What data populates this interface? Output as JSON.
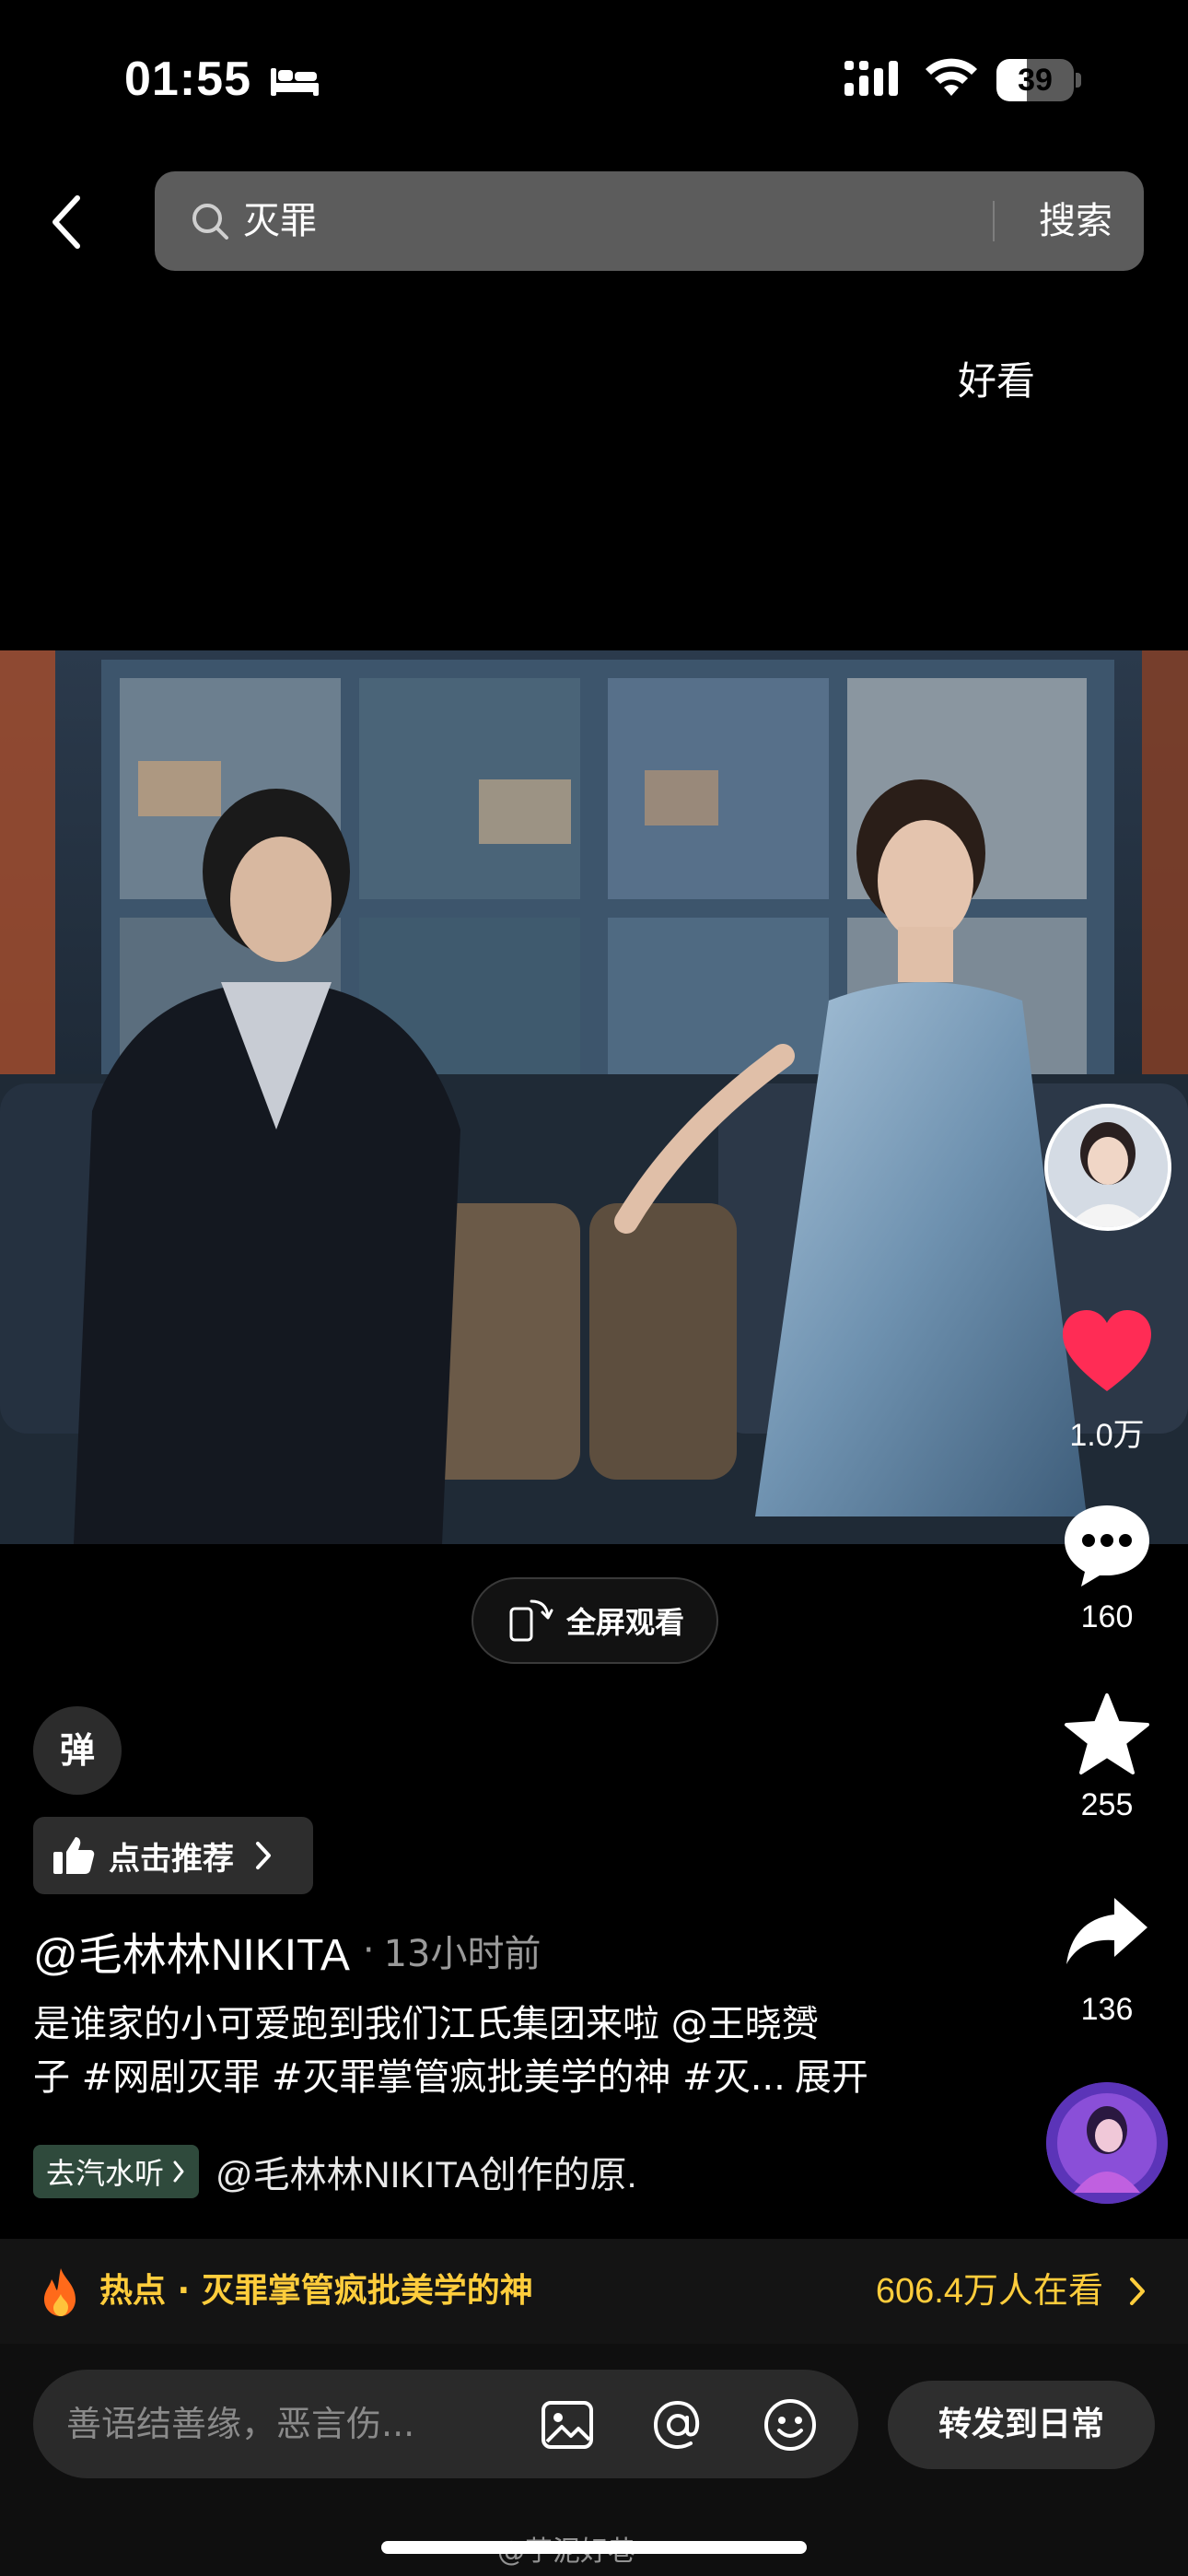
{
  "status_bar": {
    "time": "01:55",
    "battery_level": "39",
    "battery_fraction": 0.39,
    "icons": [
      "bed-icon",
      "cellular-signal-icon",
      "wifi-icon",
      "battery-icon"
    ]
  },
  "search": {
    "query": "灭罪",
    "submit_label": "搜索"
  },
  "top_label": "好看",
  "video": {
    "fullscreen_label": "全屏观看"
  },
  "rail": {
    "likes": "1.0万",
    "comments": "160",
    "favorites": "255",
    "shares": "136"
  },
  "post": {
    "danmaku_label": "弹",
    "recommend_label": "点击推荐",
    "author": "@毛林林NIKITA",
    "separator": "·",
    "time_ago": "13小时前",
    "caption_line1": "是谁家的小可爱跑到我们江氏集团来啦 @王晓赟",
    "caption_line2": "子 #网剧灭罪 #灭罪掌管疯批美学的神 #灭...",
    "expand_label": "展开",
    "music_badge": "去汽水听",
    "music_text": "@毛林林NIKITA创作的原."
  },
  "hot_bar": {
    "label": "热点 · 灭罪掌管疯批美学的神",
    "viewers": "606.4万人在看"
  },
  "bottom_bar": {
    "comment_placeholder": "善语结善缘，恶言伤...",
    "repost_label": "转发到日常"
  },
  "watermark": "@芋泥好巷",
  "colors": {
    "background": "#000000",
    "accent_yellow": "#ffcd3c",
    "like_red": "#ff2c55",
    "search_bg": "#5c5c5c"
  }
}
